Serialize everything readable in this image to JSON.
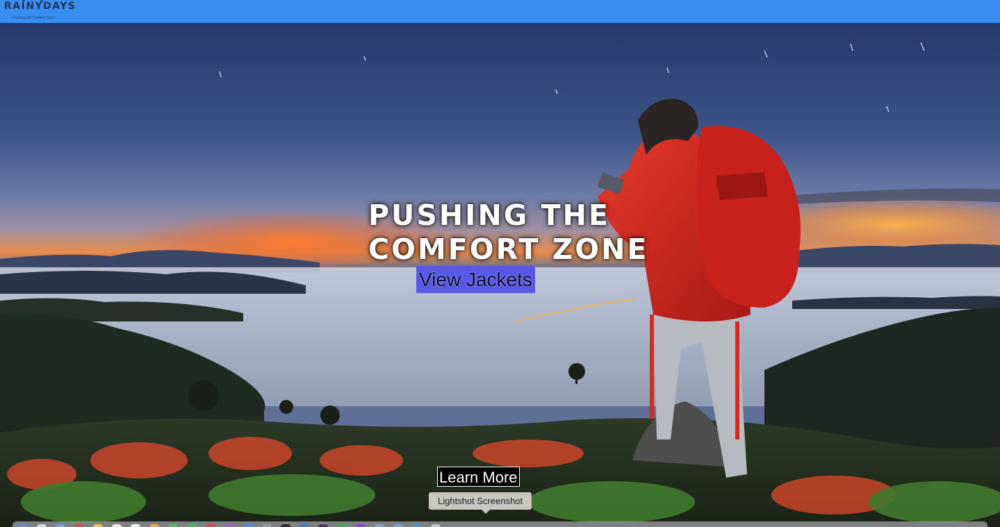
{
  "header": {
    "logo": {
      "title": "RAINYDAYS",
      "tagline": "• Pushing the Comfort Zone •"
    },
    "background_color": "#3a8ef2"
  },
  "hero": {
    "headline_line1": "PUSHING THE",
    "headline_line2": "COMFORT ZONE",
    "cta_label": "View Jackets",
    "cta_color": "#5858e6",
    "learn_more_label": "Learn More"
  },
  "tooltip": {
    "text": "Lightshot Screenshot"
  },
  "dock": {
    "icons": [
      "finder-icon",
      "launchpad-icon",
      "safari-icon",
      "chrome-icon",
      "mail-icon",
      "notes-icon",
      "calendar-icon",
      "photos-icon",
      "messages-icon",
      "facetime-icon",
      "music-icon",
      "podcasts-icon",
      "app-store-icon",
      "settings-icon",
      "terminal-icon",
      "vscode-icon",
      "slack-icon",
      "spotify-icon",
      "lightshot-icon",
      "preview-icon",
      "folder-icon",
      "downloads-icon",
      "trash-icon"
    ]
  }
}
